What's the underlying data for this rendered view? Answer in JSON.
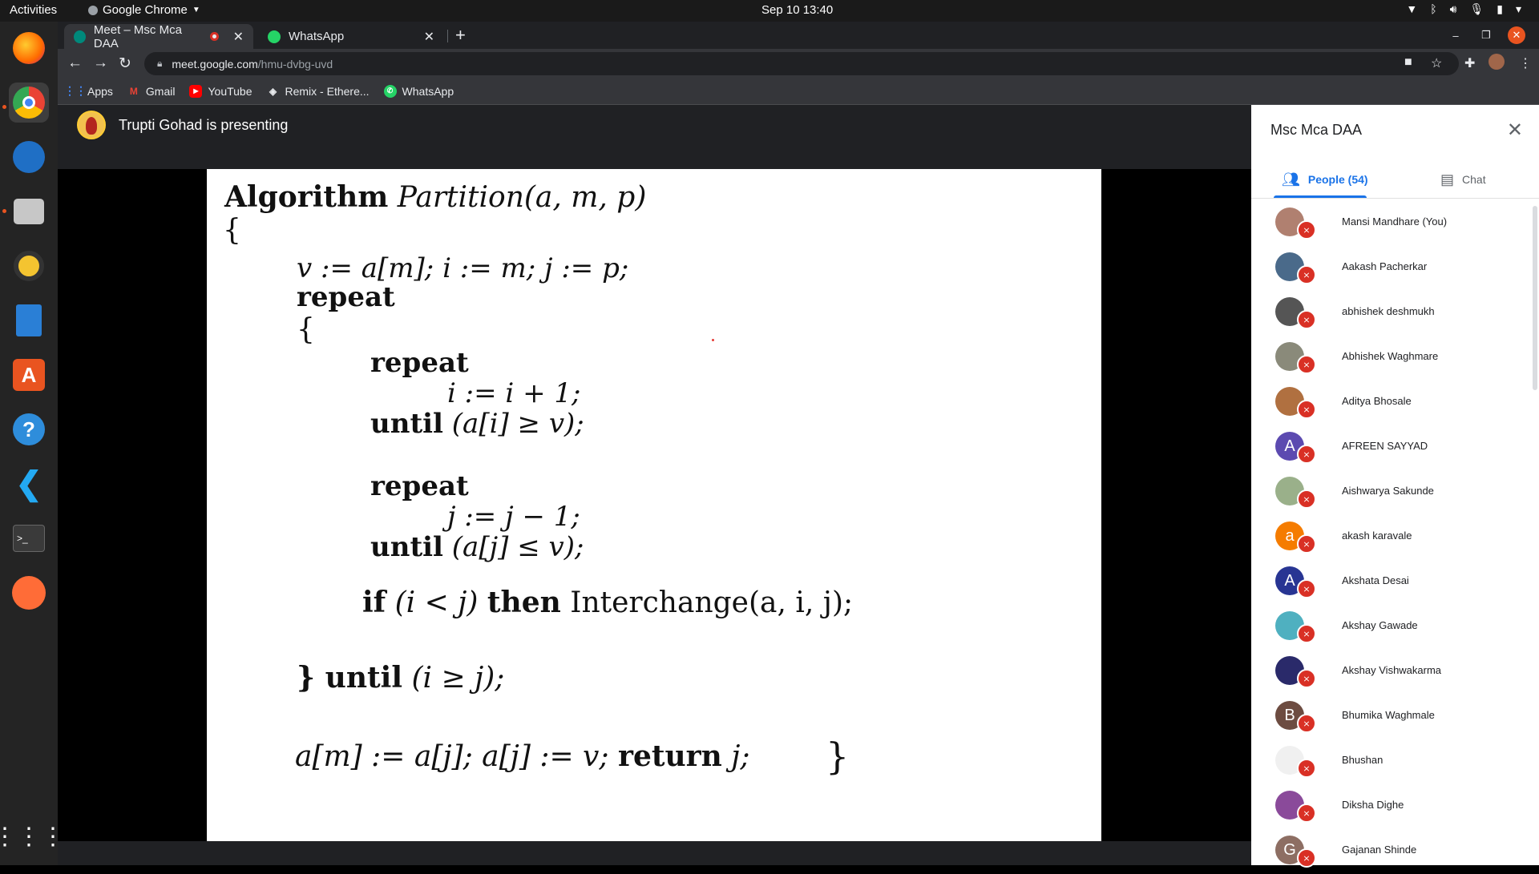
{
  "system": {
    "activities": "Activities",
    "app_name": "Google Chrome",
    "clock": "Sep 10  13:40"
  },
  "browser": {
    "tabs": [
      {
        "title": "Meet – Msc Mca DAA",
        "active": true
      },
      {
        "title": "WhatsApp",
        "active": false
      }
    ],
    "url_domain": "meet.google.com",
    "url_path": "/hmu-dvbg-uvd",
    "bookmarks": [
      "Apps",
      "Gmail",
      "YouTube",
      "Remix - Ethere...",
      "WhatsApp"
    ]
  },
  "meet": {
    "presenting_text": "Trupti Gohad is presenting",
    "slide": {
      "lines": [
        {
          "kw": "Algorithm",
          "rest": "Partition(a, m, p)"
        },
        {
          "kw": "",
          "rest": "{"
        },
        {
          "kw": "",
          "rest": "v := a[m]; i := m; j := p;"
        },
        {
          "kw": "repeat",
          "rest": ""
        },
        {
          "kw": "",
          "rest": "{"
        },
        {
          "kw": "repeat",
          "rest": ""
        },
        {
          "kw": "",
          "rest": "i := i + 1;"
        },
        {
          "kw": "until",
          "rest": "(a[i] ≥ v);"
        },
        {
          "kw": "repeat",
          "rest": ""
        },
        {
          "kw": "",
          "rest": "j := j − 1;"
        },
        {
          "kw": "until",
          "rest": "(a[j] ≤ v);"
        },
        {
          "kw": "if",
          "rest": "(i < j)"
        },
        {
          "kw": "then",
          "rest": "Interchange(a, i, j);"
        },
        {
          "kw": "} until",
          "rest": "(i ≥ j);"
        },
        {
          "kw": "",
          "rest": "a[m] := a[j]; a[j] := v;"
        },
        {
          "kw": "return",
          "rest": "j;"
        },
        {
          "kw": "",
          "rest": "}"
        }
      ]
    }
  },
  "panel": {
    "title": "Msc Mca DAA",
    "people_tab": "People (54)",
    "chat_tab": "Chat",
    "people": [
      {
        "name": "Mansi Mandhare (You)",
        "initial": "",
        "color": "#b08070"
      },
      {
        "name": "Aakash Pacherkar",
        "initial": "",
        "color": "#4a6a8a"
      },
      {
        "name": "abhishek deshmukh",
        "initial": "",
        "color": "#555555"
      },
      {
        "name": "Abhishek Waghmare",
        "initial": "",
        "color": "#8a8a7a"
      },
      {
        "name": "Aditya Bhosale",
        "initial": "",
        "color": "#b07040"
      },
      {
        "name": "AFREEN SAYYAD",
        "initial": "A",
        "color": "#5c4ab0"
      },
      {
        "name": "Aishwarya Sakunde",
        "initial": "",
        "color": "#9ab08a"
      },
      {
        "name": "akash karavale",
        "initial": "a",
        "color": "#f57c00"
      },
      {
        "name": "Akshata Desai",
        "initial": "A",
        "color": "#283593"
      },
      {
        "name": "Akshay Gawade",
        "initial": "",
        "color": "#4fb0c0"
      },
      {
        "name": "Akshay Vishwakarma",
        "initial": "",
        "color": "#2a2a6a"
      },
      {
        "name": "Bhumika Waghmale",
        "initial": "B",
        "color": "#6d4c41"
      },
      {
        "name": "Bhushan",
        "initial": "",
        "color": "#f0f0f0"
      },
      {
        "name": "Diksha Dighe",
        "initial": "",
        "color": "#8a4a9a"
      },
      {
        "name": "Gajanan Shinde",
        "initial": "G",
        "color": "#8d6e63"
      }
    ]
  }
}
